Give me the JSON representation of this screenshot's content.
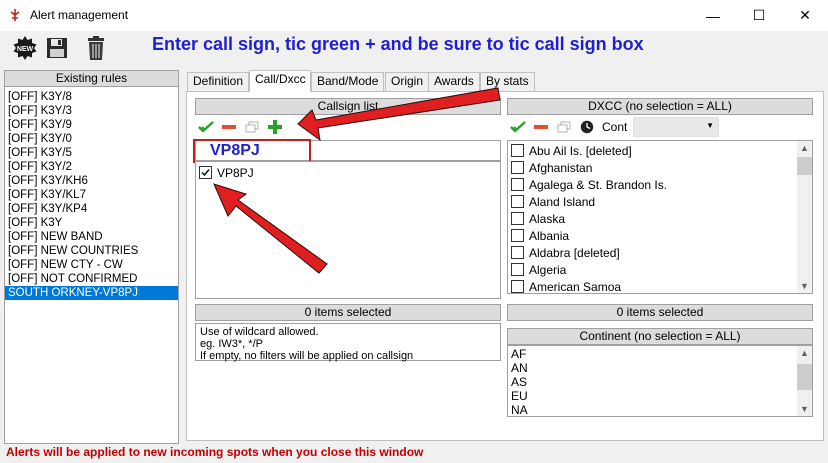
{
  "window": {
    "title": "Alert management",
    "minimize_glyph": "—",
    "maximize_glyph": "☐",
    "close_glyph": "✕"
  },
  "toolbar": {
    "new_icon_text": "NEW",
    "instruction": "Enter call sign, tic green + and be sure to tic call sign box"
  },
  "rules": {
    "header": "Existing rules",
    "items": [
      "[OFF] K3Y/8",
      "[OFF] K3Y/3",
      "[OFF] K3Y/9",
      "[OFF] K3Y/0",
      "[OFF] K3Y/5",
      "[OFF] K3Y/2",
      "[OFF] K3Y/KH6",
      "[OFF] K3Y/KL7",
      "[OFF] K3Y/KP4",
      "[OFF] K3Y",
      "[OFF] NEW BAND",
      "[OFF] NEW COUNTRIES",
      "[OFF] NEW CTY - CW",
      "[OFF] NOT CONFIRMED",
      "SOUTH ORKNEY-VP8PJ"
    ],
    "selected_index": 14
  },
  "tabs": [
    "Definition",
    "Call/Dxcc",
    "Band/Mode",
    "Origin",
    "Awards",
    "By stats"
  ],
  "active_tab": "Call/Dxcc",
  "callsign": {
    "header": "Callsign list",
    "input_value": "VP8PJ",
    "items": [
      {
        "label": "VP8PJ",
        "checked": true
      }
    ],
    "selected_status": "0 items selected",
    "help_lines": [
      "Use of wildcard allowed.",
      "eg. IW3*, */P",
      "If empty, no filters will be applied on callsign"
    ]
  },
  "dxcc": {
    "header": "DXCC (no selection = ALL)",
    "cont_label": "Cont",
    "items": [
      "Abu Ail Is. [deleted]",
      "Afghanistan",
      "Agalega & St. Brandon Is.",
      "Aland Island",
      "Alaska",
      "Albania",
      "Aldabra [deleted]",
      "Algeria",
      "American Samoa"
    ],
    "selected_status": "0 items selected"
  },
  "continent": {
    "header": "Continent (no selection = ALL)",
    "items": [
      "AF",
      "AN",
      "AS",
      "EU",
      "NA"
    ]
  },
  "footer": "Alerts will be applied to new incoming spots when you close this window",
  "colors": {
    "instruction": "#1f1fd0",
    "annotation_red": "#e02020",
    "selection": "#0078d7",
    "footer": "#c00000",
    "check_green": "#2aa02a",
    "minus_red": "#e05030"
  }
}
